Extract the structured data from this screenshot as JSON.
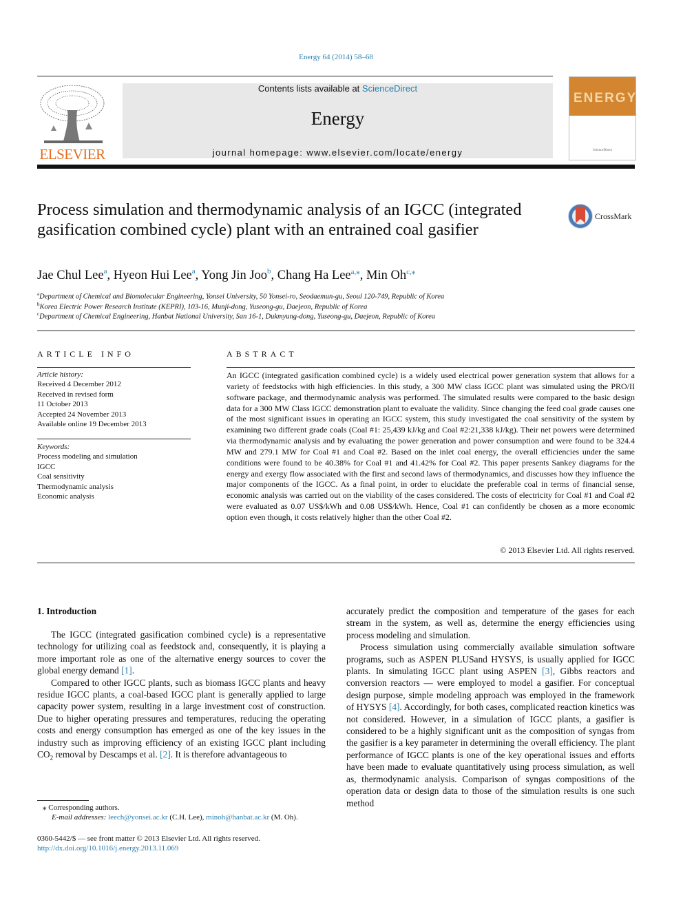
{
  "header": {
    "journal_ref": "Energy 64 (2014) 58–68",
    "contents_prefix": "Contents lists available at ",
    "contents_link": "ScienceDirect",
    "journal_name": "Energy",
    "homepage": "journal homepage: www.elsevier.com/locate/energy",
    "publisher": "ELSEVIER",
    "cover_word": "ENERGY",
    "cover_publisher": "ScienceDirect"
  },
  "colors": {
    "link": "#2a7fb0",
    "elsevier_orange": "#e46d1f",
    "cover_orange": "#d3852f",
    "banner_gray": "#e8e8e8"
  },
  "article": {
    "title": "Process simulation and thermodynamic analysis of an IGCC (integrated gasification combined cycle) plant with an entrained coal gasifier",
    "crossmark": "CrossMark",
    "authors": [
      {
        "name": "Jae Chul Lee",
        "sup": "a"
      },
      {
        "name": "Hyeon Hui Lee",
        "sup": "a"
      },
      {
        "name": "Yong Jin Joo",
        "sup": "b"
      },
      {
        "name": "Chang Ha Lee",
        "sup": "a,⁎"
      },
      {
        "name": "Min Oh",
        "sup": "c,⁎"
      }
    ],
    "affiliations": [
      {
        "sup": "a",
        "text": "Department of Chemical and Biomolecular Engineering, Yonsei University, 50 Yonsei-ro, Seodaemun-gu, Seoul 120-749, Republic of Korea"
      },
      {
        "sup": "b",
        "text": "Korea Electric Power Research Institute (KEPRI), 103-16, Munji-dong, Yuseong-gu, Daejeon, Republic of Korea"
      },
      {
        "sup": "c",
        "text": "Department of Chemical Engineering, Hanbat National University, San 16-1, Dukmyung-dong, Yuseong-gu, Daejeon, Republic of Korea"
      }
    ]
  },
  "article_info": {
    "heading": "ARTICLE INFO",
    "history_label": "Article history:",
    "history": [
      "Received 4 December 2012",
      "Received in revised form",
      "11 October 2013",
      "Accepted 24 November 2013",
      "Available online 19 December 2013"
    ],
    "keywords_label": "Keywords:",
    "keywords": [
      "Process modeling and simulation",
      "IGCC",
      "Coal sensitivity",
      "Thermodynamic analysis",
      "Economic analysis"
    ]
  },
  "abstract": {
    "heading": "ABSTRACT",
    "text": "An IGCC (integrated gasification combined cycle) is a widely used electrical power generation system that allows for a variety of feedstocks with high efficiencies. In this study, a 300 MW class IGCC plant was simulated using the PRO/II software package, and thermodynamic analysis was performed. The simulated results were compared to the basic design data for a 300 MW Class IGCC demonstration plant to evaluate the validity. Since changing the feed coal grade causes one of the most significant issues in operating an IGCC system, this study investigated the coal sensitivity of the system by examining two different grade coals (Coal #1: 25,439 kJ/kg and Coal #2:21,338 kJ/kg). Their net powers were determined via thermodynamic analysis and by evaluating the power generation and power consumption and were found to be 324.4 MW and 279.1 MW for Coal #1 and Coal #2. Based on the inlet coal energy, the overall efficiencies under the same conditions were found to be 40.38% for Coal #1 and 41.42% for Coal #2. This paper presents Sankey diagrams for the energy and exergy flow associated with the first and second laws of thermodynamics, and discusses how they influence the major components of the IGCC. As a final point, in order to elucidate the preferable coal in terms of financial sense, economic analysis was carried out on the viability of the cases considered. The costs of electricity for Coal #1 and Coal #2 were evaluated as 0.07 US$/kWh and 0.08 US$/kWh. Hence, Coal #1 can confidently be chosen as a more economic option even though, it costs relatively higher than the other Coal #2.",
    "copyright": "© 2013 Elsevier Ltd. All rights reserved."
  },
  "body": {
    "intro_heading": "1.  Introduction",
    "left_col": {
      "p1_a": "The IGCC (integrated gasification combined cycle) is a representative technology for utilizing coal as feedstock and, consequently, it is playing a more important role as one of the alternative energy sources to cover the global energy demand ",
      "p1_ref": "[1]",
      "p1_b": ".",
      "p2_a": "Compared to other IGCC plants, such as biomass IGCC plants and heavy residue IGCC plants, a coal-based IGCC plant is generally applied to large capacity power system, resulting in a large investment cost of construction. Due to higher operating pressures and temperatures, reducing the operating costs and energy consumption has emerged as one of the key issues in the industry such as improving efficiency of an existing IGCC plant including CO",
      "p2_sub": "2",
      "p2_b": " removal by Descamps et al. ",
      "p2_ref": "[2]",
      "p2_c": ". It is therefore advantageous to"
    },
    "right_col": {
      "p1": "accurately predict the composition and temperature of the gases for each stream in the system, as well as, determine the energy efficiencies using process modeling and simulation.",
      "p2_a": "Process simulation using commercially available simulation software programs, such as ASPEN PLUSand HYSYS, is usually applied for IGCC plants. In simulating IGCC plant using ASPEN ",
      "p2_ref1": "[3]",
      "p2_b": ", Gibbs reactors and conversion reactors — were employed to model a gasifier. For conceptual design purpose, simple modeling approach was employed in the framework of HYSYS ",
      "p2_ref2": "[4]",
      "p2_c": ". Accordingly, for both cases, complicated reaction kinetics was not considered. However, in a simulation of IGCC plants, a gasifier is considered to be a highly significant unit as the composition of syngas from the gasifier is a key parameter in determining the overall efficiency. The plant performance of IGCC plants is one of the key operational issues and efforts have been made to evaluate quantitatively using process simulation, as well as, thermodynamic analysis. Comparison of syngas compositions of the operation data or design data to those of the simulation results is one such method"
    }
  },
  "footnotes": {
    "corresponding": "⁎  Corresponding authors.",
    "email_label": "E-mail addresses:",
    "email1": "leech@yonsei.ac.kr",
    "email1_who": " (C.H. Lee), ",
    "email2": "minoh@hanbat.ac.kr",
    "email2_who": " (M. Oh).",
    "issn": "0360-5442/$ — see front matter © 2013 Elsevier Ltd. All rights reserved.",
    "doi": "http://dx.doi.org/10.1016/j.energy.2013.11.069"
  }
}
